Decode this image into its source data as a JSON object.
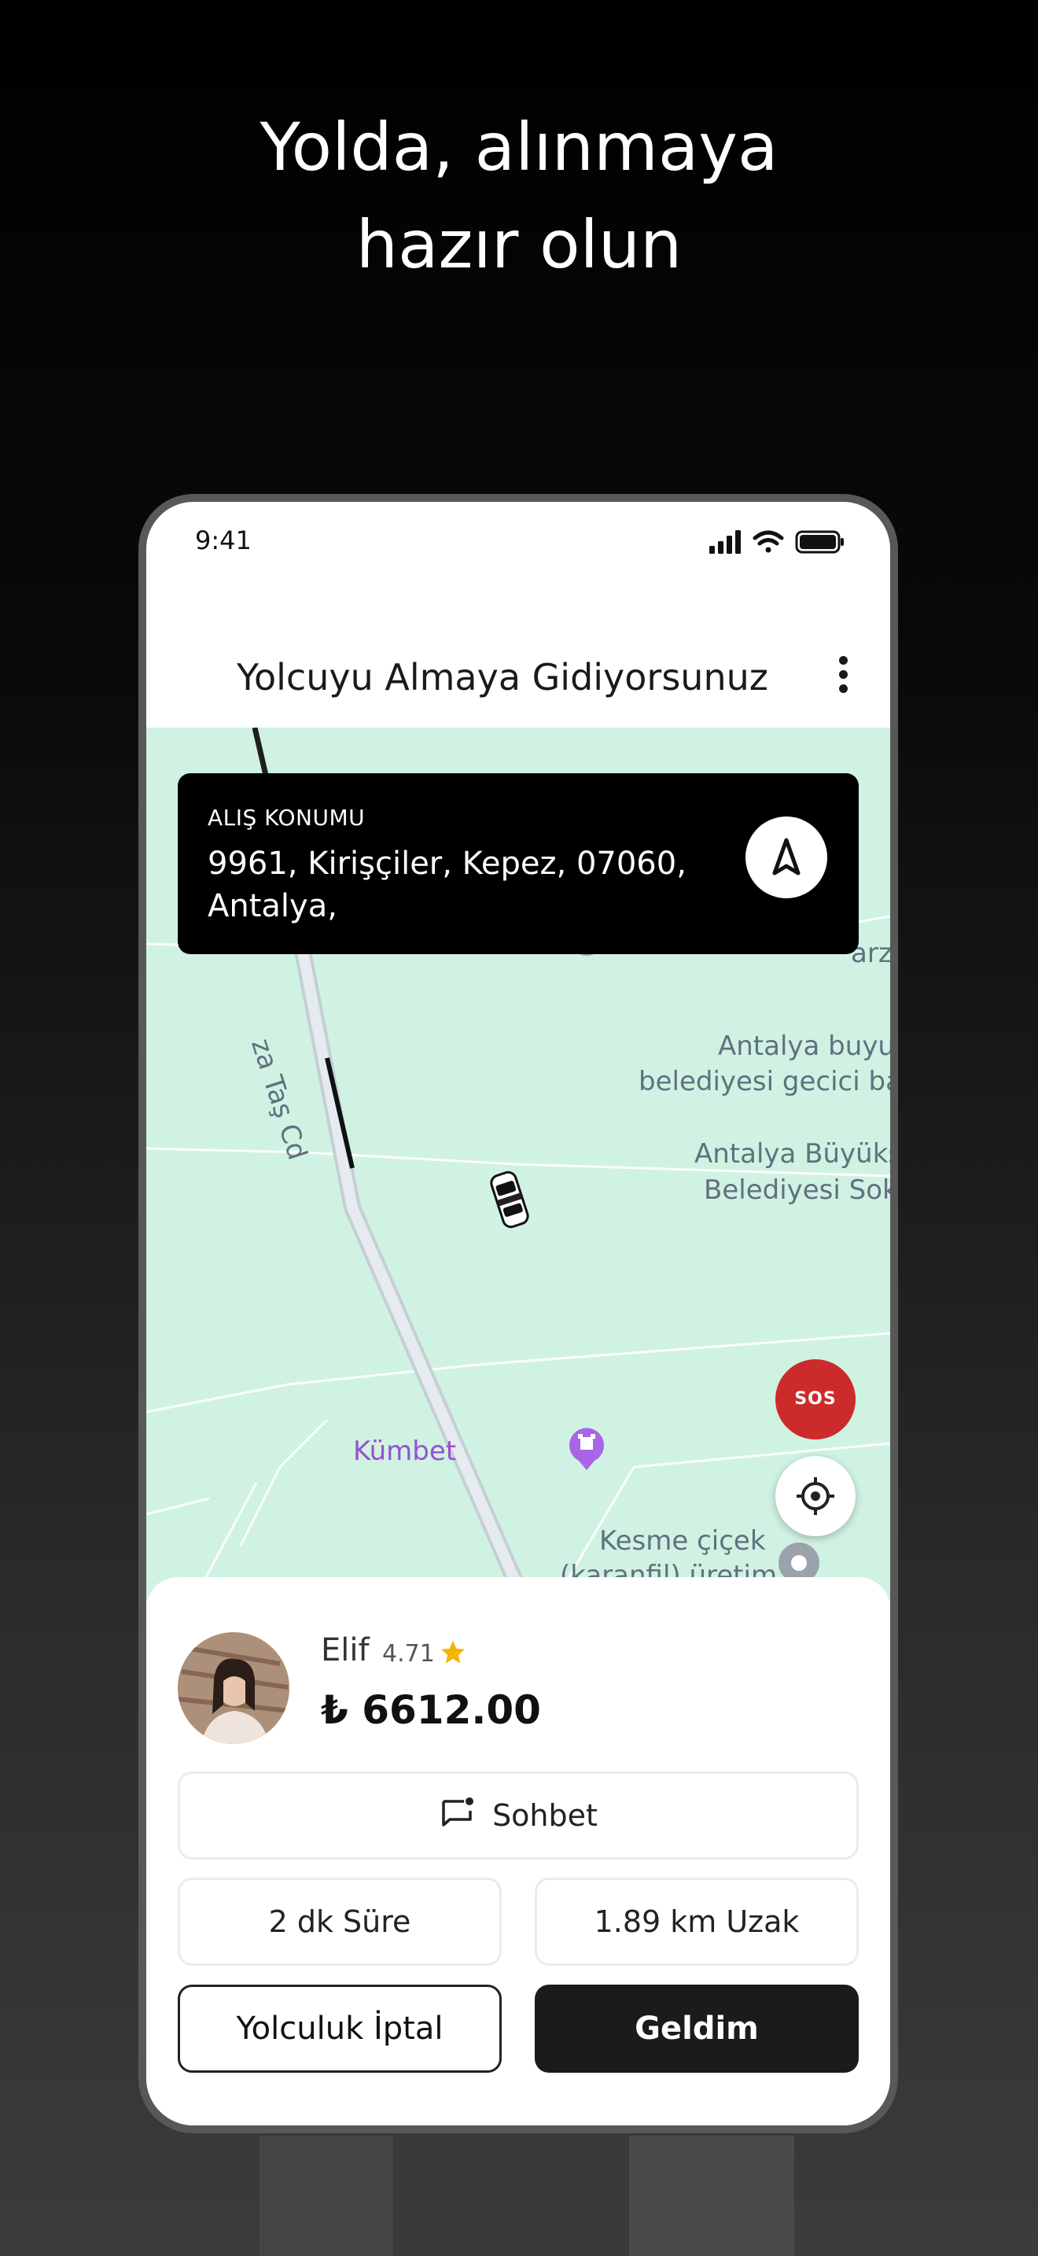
{
  "headline": {
    "line1": "Yolda, alınmaya",
    "line2": "hazır olun"
  },
  "status_bar": {
    "time": "9:41",
    "icons": [
      "signal-icon",
      "wifi-icon",
      "battery-icon"
    ]
  },
  "header": {
    "title": "Yolcuyu Almaya Gidiyorsunuz",
    "menu_icon": "more-vertical-icon"
  },
  "pickup": {
    "label": "ALIŞ KONUMU",
    "address": "9961, Kirişçiler, Kepez, 07060, Antalya,",
    "nav_icon": "navigation-arrow-icon"
  },
  "map": {
    "labels": {
      "street": "za Taş Cd",
      "partial_top": "arz",
      "poi1": "Antalya buyuk",
      "poi1_line2": "belediyesi gecici ba",
      "poi2": "Antalya Büyükş",
      "poi2_line2": "Belediyesi Sok",
      "kumbet": "Kümbet",
      "kesme": "Kesme çiçek",
      "kesme_line2": "(karanfil) üretim"
    },
    "sos_label": "SOS",
    "locate_icon": "crosshair-icon",
    "car_icon": "car-icon"
  },
  "driver": {
    "name": "Elif",
    "rating": "4.71",
    "fare": "₺ 6612.00"
  },
  "actions": {
    "chat_label": "Sohbet",
    "duration": "2 dk Süre",
    "distance": "1.89 km Uzak",
    "cancel_label": "Yolculuk İptal",
    "arrived_label": "Geldim"
  },
  "colors": {
    "map_bg": "#d0f2e2",
    "sos": "#cc2b2b",
    "star": "#f4b400",
    "primary_dark": "#1b1b1b",
    "route": "#222222"
  }
}
